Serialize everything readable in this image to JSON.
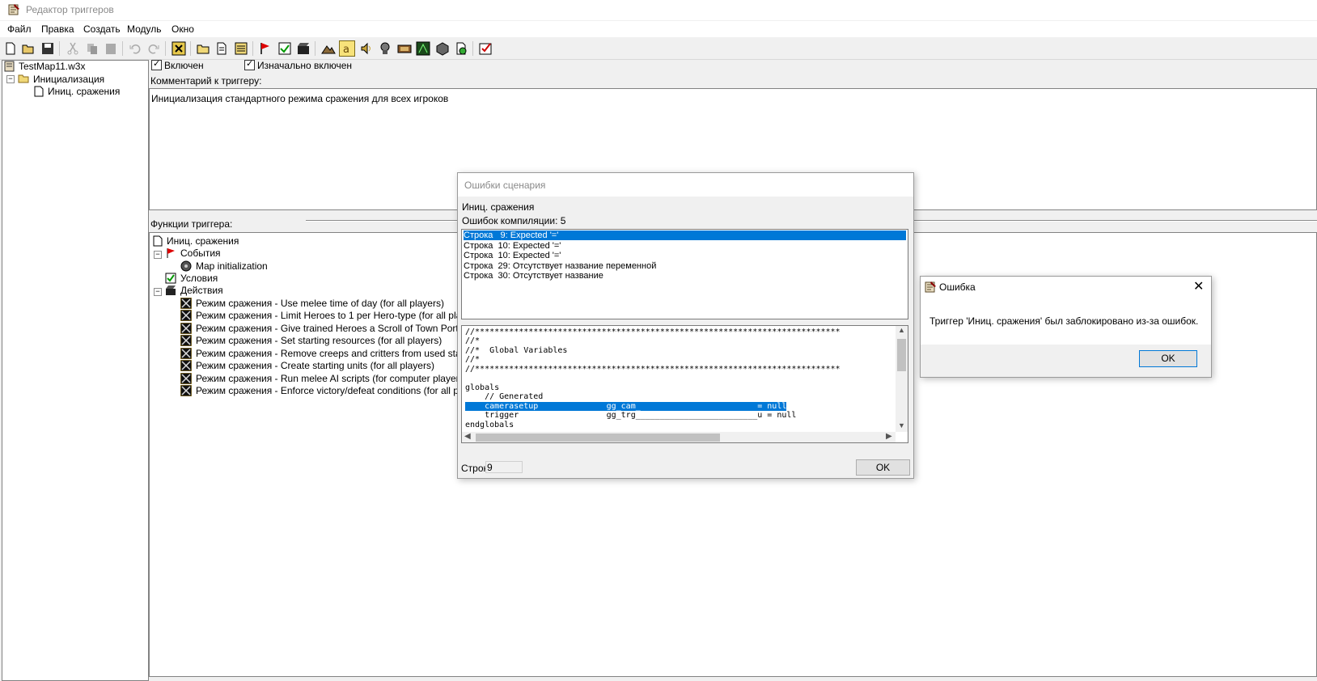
{
  "window": {
    "title": "Редактор триггеров"
  },
  "menu": [
    "Файл",
    "Правка",
    "Создать",
    "Модуль",
    "Окно"
  ],
  "toolbar": {
    "icons": [
      "new-icon",
      "open-icon",
      "save-icon",
      "cut-icon",
      "copy-icon",
      "paste-icon",
      "undo-icon",
      "redo-icon",
      "delete-icon",
      "new-category-icon",
      "new-trigger-icon",
      "new-comment-icon",
      "new-event-icon",
      "new-condition-icon",
      "new-action-icon",
      "terrain-editor-icon",
      "unit-editor-icon",
      "sound-editor-icon",
      "object-editor-icon",
      "campaign-editor-icon",
      "ai-editor-icon",
      "import-manager-icon",
      "test-map-icon",
      "record-icon"
    ]
  },
  "tree": {
    "map": "TestMap11.w3x",
    "category": "Инициализация",
    "trigger": "Иниц. сражения"
  },
  "trigger": {
    "enabled_label": "Включен",
    "initially_on_label": "Изначально включен",
    "comment_label": "Комментарий к триггеру:",
    "comment": "Инициализация стандартного режима сражения для всех игроков",
    "functions_label": "Функции триггера:",
    "root": "Иниц. сражения",
    "events_label": "События",
    "event": "Map initialization",
    "conditions_label": "Условия",
    "actions_label": "Действия",
    "actions": [
      "Режим сражения - Use melee time of day (for all players)",
      "Режим сражения - Limit Heroes to 1 per Hero-type (for all players)",
      "Режим сражения - Give trained Heroes a Scroll of Town Portal (for all",
      "Режим сражения - Set starting resources (for all players)",
      "Режим сражения - Remove creeps and critters from used start location",
      "Режим сражения - Create starting units (for all players)",
      "Режим сражения - Run melee AI scripts (for computer players)",
      "Режим сражения - Enforce victory/defeat conditions (for all players)"
    ]
  },
  "script_errors": {
    "title": "Ошибки сценария",
    "trigger_name": "Иниц. сражения",
    "count_label": "Ошибок компиляции: 5",
    "errors": [
      "Строка   9: Expected '='",
      "Строка  10: Expected '='",
      "Строка  10: Expected '='",
      "Строка  29: Отсутствует название переменной",
      "Строка  30: Отсутствует название"
    ],
    "code": [
      "//***************************************************************************",
      "//*",
      "//*  Global Variables",
      "//*",
      "//***************************************************************************",
      "",
      "globals",
      "    // Generated",
      "    camerasetup              gg_cam_                        = null",
      "    trigger                  gg_trg_________________________u = null",
      "endglobals"
    ],
    "line_label": "Строк",
    "line_value": "9",
    "ok_label": "OK"
  },
  "error_box": {
    "title": "Ошибка",
    "message": "Триггер 'Иниц. сражения' был заблокировано из-за ошибок.",
    "ok_label": "OK"
  }
}
